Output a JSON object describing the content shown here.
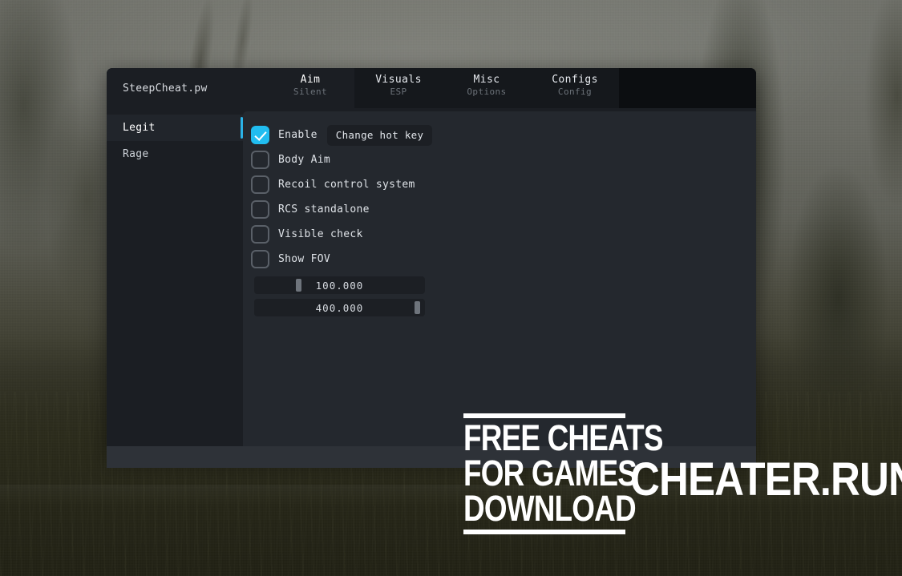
{
  "window": {
    "brand": "SteepCheat.pw",
    "tabs": [
      {
        "main": "Aim",
        "sub": "Silent",
        "active": true
      },
      {
        "main": "Visuals",
        "sub": "ESP",
        "active": false
      },
      {
        "main": "Misc",
        "sub": "Options",
        "active": false
      },
      {
        "main": "Configs",
        "sub": "Config",
        "active": false
      }
    ],
    "sidebar": {
      "items": [
        {
          "label": "Legit",
          "active": true
        },
        {
          "label": "Rage",
          "active": false
        }
      ]
    },
    "content": {
      "checkboxes": [
        {
          "label": "Enable",
          "checked": true
        },
        {
          "label": "Body Aim",
          "checked": false
        },
        {
          "label": "Recoil control system",
          "checked": false
        },
        {
          "label": "RCS standalone",
          "checked": false
        },
        {
          "label": "Visible check",
          "checked": false
        },
        {
          "label": "Show FOV",
          "checked": false
        }
      ],
      "hotkey_button": "Change hot key",
      "sliders": [
        {
          "value": "100.000",
          "handle_pct": 25
        },
        {
          "value": "400.000",
          "handle_pct": 97
        }
      ]
    }
  },
  "watermarks": {
    "left_lines": [
      "FREE CHEATS",
      "FOR GAMES",
      "DOWNLOAD"
    ],
    "right": "CHEATER.RUN"
  },
  "colors": {
    "accent": "#2bb3e8",
    "checkbox_on": "#21bdf0",
    "window_bg": "#1b1e23",
    "panel_bg": "#24282e",
    "topbar_bg": "#15181c",
    "footer_bg": "#2e3238"
  }
}
